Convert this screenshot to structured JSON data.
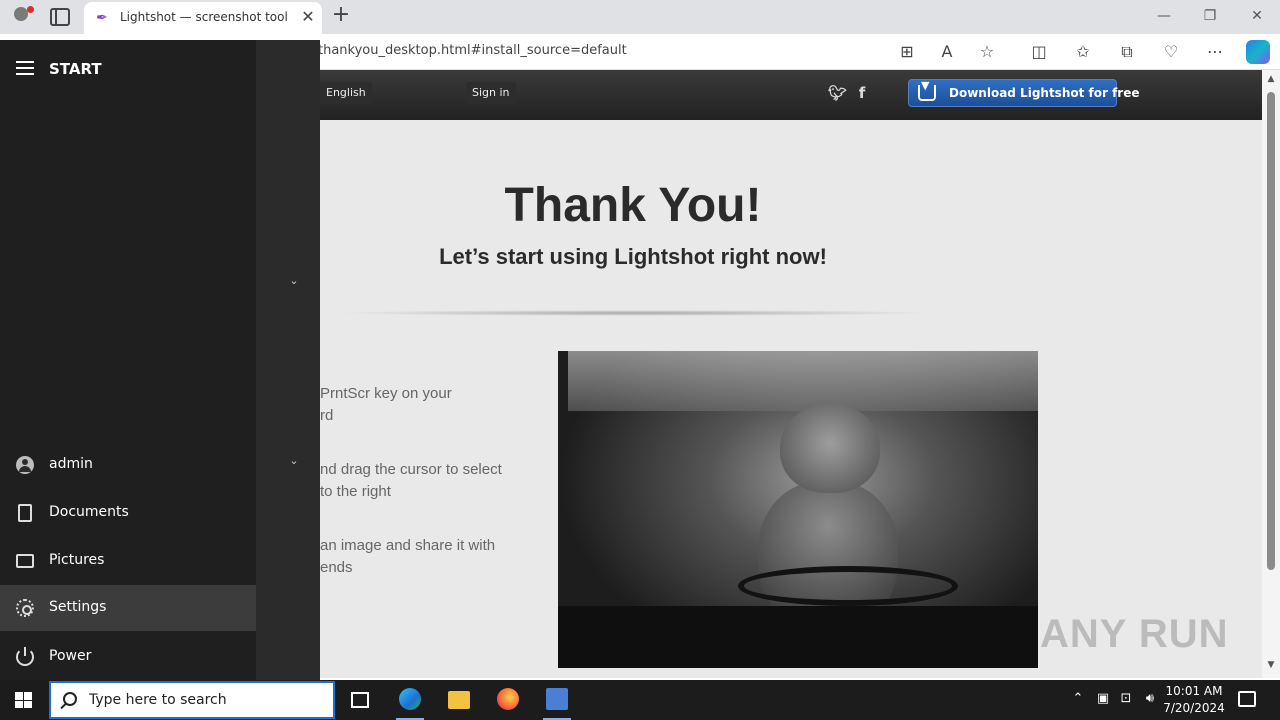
{
  "browser": {
    "tab_title": "Lightshot — screenshot tool for M",
    "address": "thankyou_desktop.html#install_source=default"
  },
  "page": {
    "language": "English",
    "signin": "Sign in",
    "download": "Download Lightshot for free",
    "title": "Thank You!",
    "subtitle": "Let’s start using Lightshot right now!",
    "steps": [
      [
        "PrntScr key on your",
        "rd"
      ],
      [
        "nd drag the cursor to select",
        "to the right"
      ],
      [
        "an image and share it with",
        "ends"
      ]
    ],
    "watermark": "ANY RUN"
  },
  "start_menu": {
    "title": "START",
    "user": "admin",
    "items": [
      "Documents",
      "Pictures",
      "Settings",
      "Power"
    ]
  },
  "taskbar": {
    "search_placeholder": "Type here to search",
    "time": "10:01 AM",
    "date": "7/20/2024"
  },
  "colors": {
    "accent": "#1e6fd9",
    "download_button": "#2f6fc4",
    "start_menu_bg": "#1f1f1f",
    "taskbar_bg": "#1c1c1c"
  }
}
